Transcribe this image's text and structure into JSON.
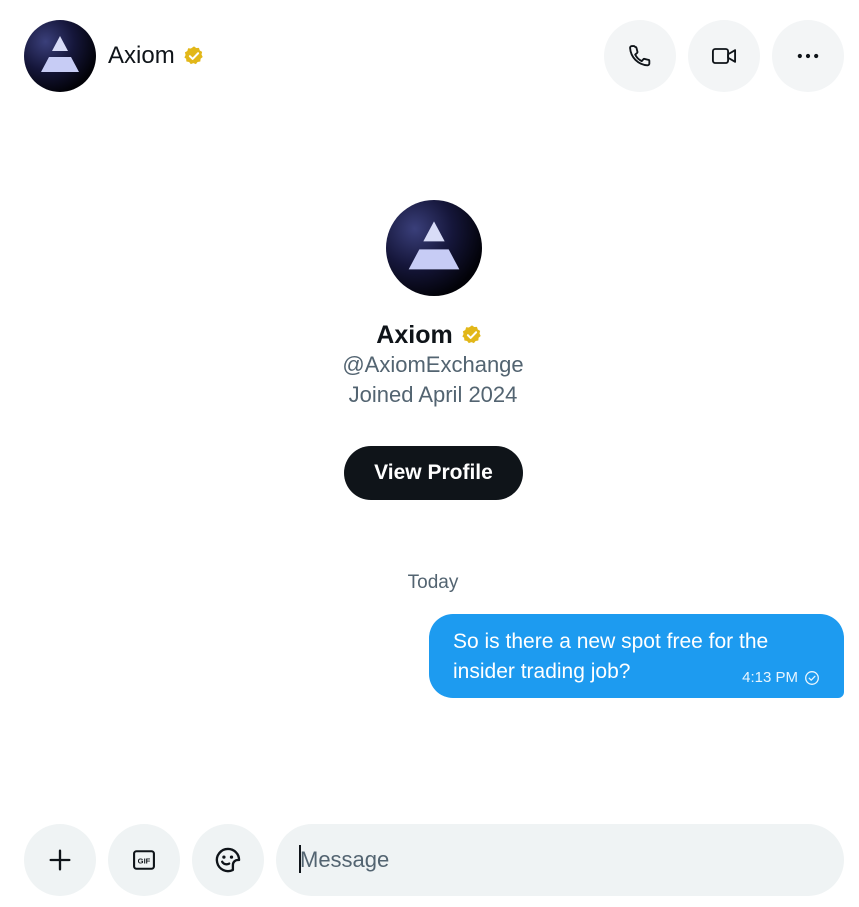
{
  "header": {
    "name": "Axiom",
    "verified": true
  },
  "profile": {
    "name": "Axiom",
    "handle": "@AxiomExchange",
    "joined": "Joined April 2024",
    "view_profile_label": "View Profile"
  },
  "conversation": {
    "date_label": "Today",
    "messages": [
      {
        "text": "So is there a new spot free for the insider trading job?",
        "time": "4:13 PM",
        "direction": "outgoing",
        "status": "sent"
      }
    ]
  },
  "composer": {
    "placeholder": "Message",
    "value": ""
  },
  "icons": {
    "phone": "phone-icon",
    "video": "video-icon",
    "more": "more-icon",
    "add": "plus-icon",
    "gif": "gif-icon",
    "emoji": "emoji-icon",
    "verified": "verified-badge-icon",
    "sent": "sent-check-icon"
  },
  "colors": {
    "accent": "#1d9bf0",
    "verified_gold": "#e2b719",
    "primary_button": "#0f1419",
    "secondary_text": "#536471"
  }
}
